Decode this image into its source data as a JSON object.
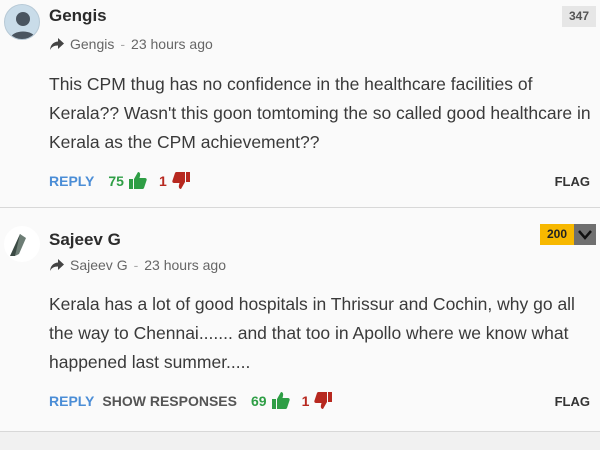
{
  "comments": [
    {
      "username": "Gengis",
      "reply_to": "Gengis",
      "separator": "-",
      "time": "23 hours ago",
      "score": "347",
      "text": "This CPM thug has no confidence in the healthcare facilities of Kerala?? Wasn't this goon tomtoming the so called good healthcare in Kerala as the CPM achievement??",
      "reply_label": "REPLY",
      "upvotes": "75",
      "downvotes": "1",
      "flag_label": "FLAG"
    },
    {
      "username": "Sajeev G",
      "reply_to": "Sajeev G",
      "separator": "-",
      "time": "23 hours ago",
      "score": "200",
      "text": "Kerala has a lot of good hospitals in Thrissur and Cochin, why go all the way to Chennai....... and that too in Apollo where we know what happened last summer.....",
      "reply_label": "REPLY",
      "show_responses_label": "SHOW RESPONSES",
      "upvotes": "69",
      "downvotes": "1",
      "flag_label": "FLAG"
    }
  ],
  "colors": {
    "reply": "#4b8dd6",
    "upvote": "#2e9e45",
    "downvote": "#b7281f",
    "score_badge_highlight": "#f7b800"
  },
  "icons": {
    "reply_arrow": "share-arrow-icon",
    "upvote": "thumbs-up-icon",
    "downvote": "thumbs-down-icon",
    "expand": "chevron-down-icon"
  }
}
